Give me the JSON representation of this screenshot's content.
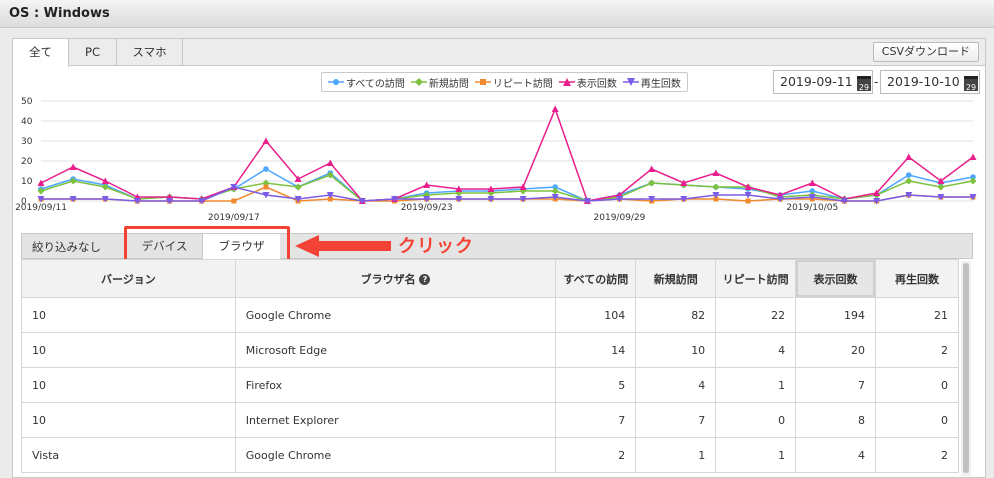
{
  "window": {
    "title": "OS : Windows"
  },
  "tabs": [
    {
      "label": "全て",
      "active": true
    },
    {
      "label": "PC",
      "active": false
    },
    {
      "label": "スマホ",
      "active": false
    }
  ],
  "csv_button": "CSVダウンロード",
  "date_range": {
    "start": "2019-09-11",
    "end": "2019-10-10",
    "separator": "-",
    "calendar_day": "29"
  },
  "chart_data": {
    "type": "line",
    "ylim": [
      0,
      50
    ],
    "yticks": [
      "0",
      "10",
      "20",
      "30",
      "40",
      "50"
    ],
    "x": [
      "2019/09/11",
      "2019/09/12",
      "2019/09/13",
      "2019/09/14",
      "2019/09/15",
      "2019/09/16",
      "2019/09/17",
      "2019/09/18",
      "2019/09/19",
      "2019/09/20",
      "2019/09/21",
      "2019/09/22",
      "2019/09/23",
      "2019/09/24",
      "2019/09/25",
      "2019/09/26",
      "2019/09/27",
      "2019/09/28",
      "2019/09/29",
      "2019/09/30",
      "2019/10/01",
      "2019/10/02",
      "2019/10/03",
      "2019/10/04",
      "2019/10/05",
      "2019/10/06",
      "2019/10/07",
      "2019/10/08",
      "2019/10/09",
      "2019/10/10"
    ],
    "xtick_labels": [
      {
        "index": 0,
        "label": "2019/09/11"
      },
      {
        "index": 6,
        "label": "2019/09/17"
      },
      {
        "index": 12,
        "label": "2019/09/23"
      },
      {
        "index": 18,
        "label": "2019/09/29"
      },
      {
        "index": 24,
        "label": "2019/10/05"
      }
    ],
    "series": [
      {
        "name": "すべての訪問",
        "color": "#4da6ff",
        "marker": "circle",
        "values": [
          6,
          11,
          8,
          1,
          2,
          1,
          6,
          16,
          7,
          14,
          0,
          1,
          4,
          5,
          5,
          6,
          7,
          0,
          3,
          9,
          8,
          7,
          6,
          3,
          5,
          1,
          3,
          13,
          9,
          12
        ]
      },
      {
        "name": "新規訪問",
        "color": "#7cc23f",
        "marker": "diamond",
        "values": [
          5,
          10,
          7,
          1,
          2,
          1,
          6,
          9,
          7,
          13,
          0,
          1,
          3,
          4,
          4,
          5,
          5,
          0,
          2,
          9,
          8,
          7,
          7,
          2,
          3,
          1,
          3,
          10,
          7,
          10
        ]
      },
      {
        "name": "リピート訪問",
        "color": "#f08a2e",
        "marker": "square",
        "values": [
          1,
          1,
          1,
          0,
          0,
          0,
          0,
          7,
          0,
          1,
          0,
          0,
          1,
          1,
          1,
          1,
          1,
          0,
          1,
          0,
          1,
          1,
          0,
          1,
          1,
          0,
          0,
          3,
          2,
          2
        ]
      },
      {
        "name": "表示回数",
        "color": "#e91e8c",
        "marker": "triangle",
        "values": [
          9,
          17,
          10,
          2,
          2,
          1,
          7,
          30,
          11,
          19,
          0,
          1,
          8,
          6,
          6,
          7,
          46,
          0,
          3,
          16,
          9,
          14,
          7,
          3,
          9,
          1,
          4,
          22,
          10,
          22
        ]
      },
      {
        "name": "再生回数",
        "color": "#7a5ce6",
        "marker": "triangle-down",
        "values": [
          1,
          1,
          1,
          0,
          0,
          0,
          7,
          3,
          1,
          3,
          0,
          1,
          1,
          1,
          1,
          1,
          2,
          0,
          1,
          1,
          1,
          3,
          3,
          1,
          2,
          0,
          0,
          3,
          2,
          2
        ]
      }
    ]
  },
  "filter": {
    "label": "絞り込みなし",
    "options": [
      {
        "label": "デバイス",
        "active": false
      },
      {
        "label": "ブラウザ",
        "active": true
      }
    ]
  },
  "annotation": {
    "text": "クリック",
    "color": "#f44336"
  },
  "table": {
    "headers": [
      "バージョン",
      "ブラウザ名",
      "すべての訪問",
      "新規訪問",
      "リピート訪問",
      "表示回数",
      "再生回数"
    ],
    "help_icon": "?",
    "rows": [
      [
        "10",
        "Google Chrome",
        "104",
        "82",
        "22",
        "194",
        "21"
      ],
      [
        "10",
        "Microsoft Edge",
        "14",
        "10",
        "4",
        "20",
        "2"
      ],
      [
        "10",
        "Firefox",
        "5",
        "4",
        "1",
        "7",
        "0"
      ],
      [
        "10",
        "Internet Explorer",
        "7",
        "7",
        "0",
        "8",
        "0"
      ],
      [
        "Vista",
        "Google Chrome",
        "2",
        "1",
        "1",
        "4",
        "2"
      ]
    ]
  }
}
